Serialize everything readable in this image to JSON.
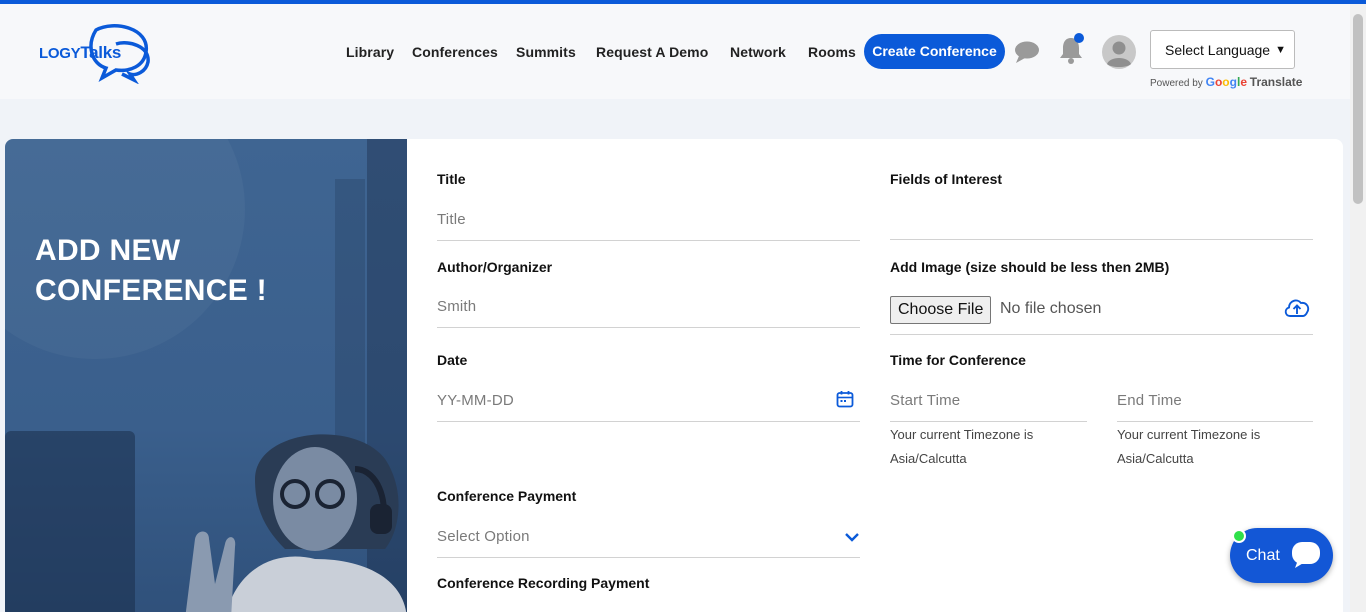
{
  "brand": {
    "logo_part1": "LOGY",
    "logo_part2": "Talks"
  },
  "nav": {
    "library": "Library",
    "conferences": "Conferences",
    "summits": "Summits",
    "request_demo": "Request A Demo",
    "network": "Network",
    "rooms": "Rooms",
    "create_conference": "Create Conference"
  },
  "language": {
    "select_label": "Select Language",
    "powered_by": "Powered by",
    "google": [
      "G",
      "o",
      "o",
      "g",
      "l",
      "e"
    ],
    "translate": "Translate"
  },
  "hero": {
    "title": "ADD NEW CONFERENCE !"
  },
  "form": {
    "title_label": "Title",
    "title_placeholder": "Title",
    "author_label": "Author/Organizer",
    "author_placeholder": "Smith",
    "date_label": "Date",
    "date_placeholder": "YY-MM-DD",
    "payment_label": "Conference Payment",
    "payment_placeholder": "Select Option",
    "recording_label": "Conference Recording Payment",
    "fields_label": "Fields of Interest",
    "image_label": "Add Image (size should be less then 2MB)",
    "choose_file": "Choose File",
    "no_file": "No file chosen",
    "time_label": "Time for Conference",
    "start_time": "Start Time",
    "end_time": "End Time",
    "tz_start_line1": "Your current Timezone is",
    "tz_start_line2": "Asia/Calcutta",
    "tz_end_line1": "Your current Timezone is",
    "tz_end_line2": "Asia/Calcutta"
  },
  "chat": {
    "label": "Chat"
  },
  "colors": {
    "accent": "#0b5ad9",
    "hero": "#3f6592",
    "online": "#2fe04a"
  },
  "icons": [
    "chat-bubble-icon",
    "bell-icon",
    "avatar-icon",
    "calendar-icon",
    "cloud-upload-icon",
    "chevron-down-icon",
    "chat-icon"
  ]
}
